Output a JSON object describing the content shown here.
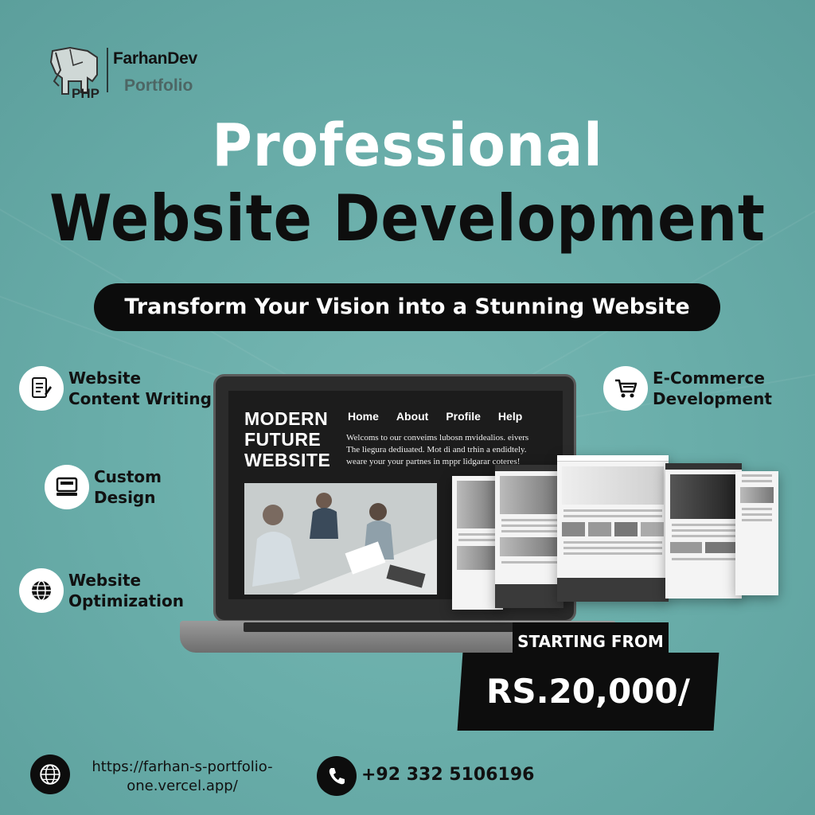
{
  "brand": {
    "name": "FarhanDev",
    "sub": "Portfolio",
    "php_label": "PHP"
  },
  "headline": {
    "line1": "Professional",
    "line2": "Website Development"
  },
  "tagline": "Transform Your Vision into a Stunning Website",
  "services": [
    {
      "icon": "document-pen-icon",
      "label_line1": "Website",
      "label_line2": "Content Writing"
    },
    {
      "icon": "monitor-icon",
      "label_line1": "Custom",
      "label_line2": "Design"
    },
    {
      "icon": "globe-icon",
      "label_line1": "Website",
      "label_line2": "Optimization"
    },
    {
      "icon": "cart-icon",
      "label_line1": "E-Commerce",
      "label_line2": "Development"
    }
  ],
  "mockup": {
    "site_title_line1": "MODERN",
    "site_title_line2": "FUTURE",
    "site_title_line3": "WEBSITE",
    "nav": [
      "Home",
      "About",
      "Profile",
      "Help"
    ],
    "desc_line1": "Welcoms to our conveims lubosn mvidealios. eivers",
    "desc_line2": "The liegura dediuated.  Mot di and trhin a endidtely.",
    "desc_line3": "weare your your partnes in mppr lidgarar coteres!"
  },
  "price": {
    "label": "STARTING FROM",
    "value": "RS.20,000/"
  },
  "footer": {
    "url_line1": "https://farhan-s-portfolio-",
    "url_line2": "one.vercel.app/",
    "phone": "+92 332 5106196"
  },
  "colors": {
    "background": "#6aaeaa",
    "dark": "#0d0d0d",
    "white": "#ffffff"
  }
}
